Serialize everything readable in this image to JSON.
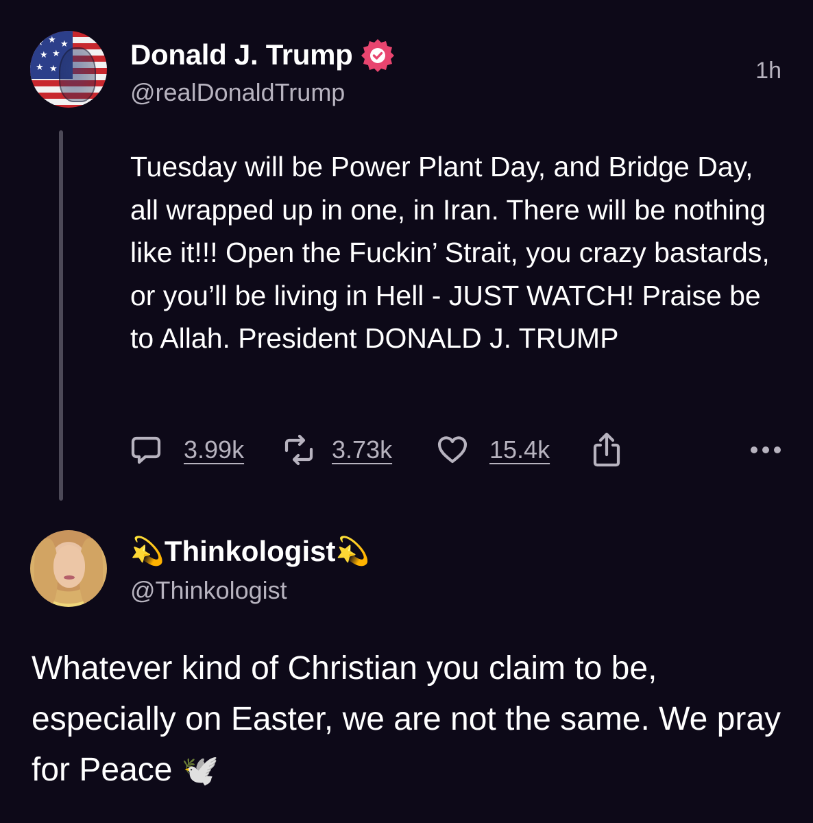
{
  "post": {
    "author": {
      "display_name": "Donald J. Trump",
      "handle": "@realDonaldTrump",
      "verified": true,
      "avatar": "avatar-american-flag-face"
    },
    "time": "1h",
    "text": "Tuesday will be Power Plant Day, and Bridge Day, all wrapped up in one, in Iran. There will be nothing like it!!! Open the Fuckin’ Strait, you crazy bastards, or you’ll be living in Hell - JUST WATCH! Praise be to Allah. President DONALD J. TRUMP",
    "actions": {
      "replies": "3.99k",
      "reposts": "3.73k",
      "likes": "15.4k",
      "icons": [
        "comment-icon",
        "repost-icon",
        "heart-icon",
        "share-icon",
        "more-icon"
      ]
    }
  },
  "reply": {
    "author": {
      "name_prefix_emoji": "💫",
      "display_name": "Thinkologist",
      "name_suffix_emoji": "💫",
      "handle": "@Thinkologist",
      "avatar": "avatar-blonde-woman"
    },
    "text": "Whatever kind of Christian you claim to be, especially on Easter, we are not the same. We pray for Peace",
    "trailing_emoji": "🕊️"
  },
  "colors": {
    "background": "#0d0918",
    "text_primary": "#ffffff",
    "text_secondary": "#b7b3bf",
    "verified_badge": "#e8456f",
    "thread_line": "#4c4957"
  }
}
